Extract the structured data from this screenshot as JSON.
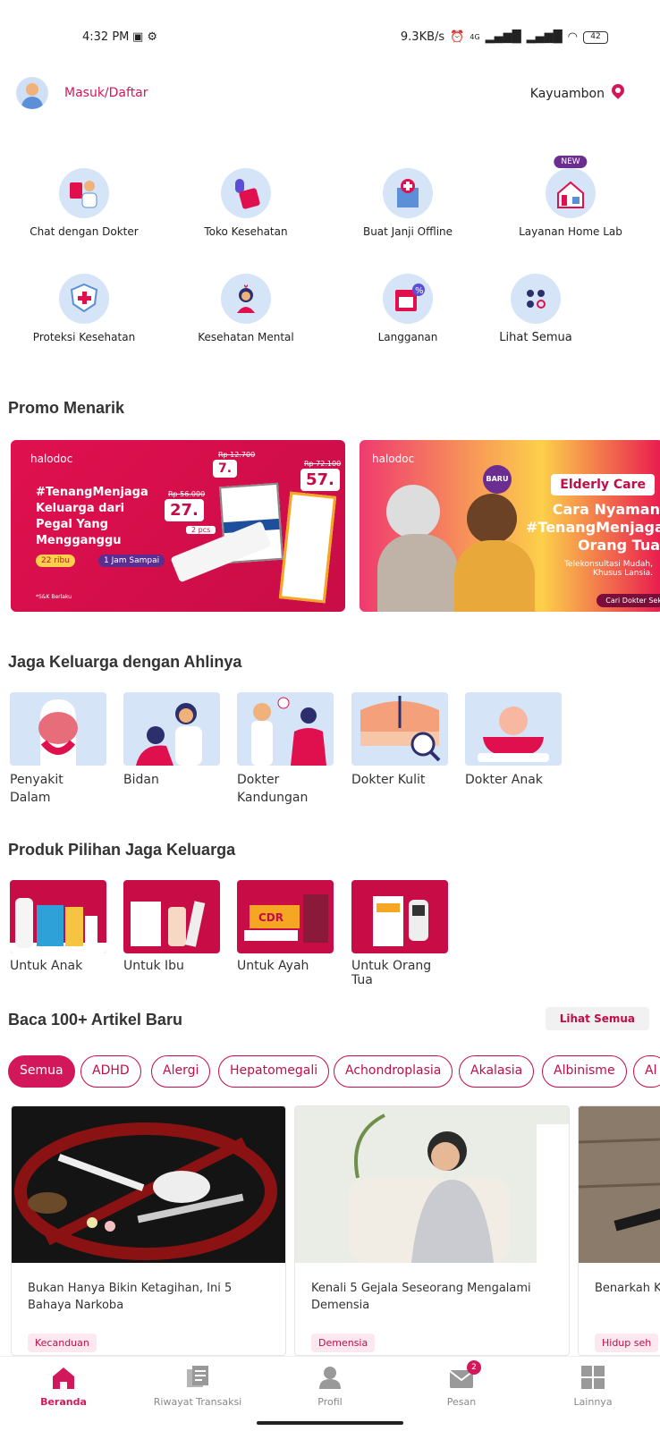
{
  "status": {
    "time": "4:32 PM",
    "speed": "9.3KB/s",
    "network": "4G",
    "battery": "42"
  },
  "header": {
    "login": "Masuk/Daftar",
    "location": "Kayuambon"
  },
  "services": [
    {
      "label": "Chat dengan Dokter",
      "icon": "doctor-icon"
    },
    {
      "label": "Toko Kesehatan",
      "icon": "medicine-icon"
    },
    {
      "label": "Buat Janji Offline",
      "icon": "hospital-icon"
    },
    {
      "label": "Layanan Home Lab",
      "icon": "home-lab-icon",
      "badge": "NEW"
    },
    {
      "label": "Proteksi Kesehatan",
      "icon": "shield-icon"
    },
    {
      "label": "Kesehatan Mental",
      "icon": "mental-health-icon"
    },
    {
      "label": "Langganan",
      "icon": "subscription-icon"
    },
    {
      "label": "Lihat Semua",
      "icon": "grid-dots-icon"
    }
  ],
  "promo": {
    "title": "Promo Menarik",
    "banner1": {
      "brand": "halodoc",
      "headline": "#TenangMenjaga Keluarga dari Pegal Yang Mengganggu",
      "old1": "Rp 56.000",
      "new1": "27.",
      "pcs": "2 pcs",
      "old2": "Rp 12.700",
      "new2": "7.",
      "old3": "Rp 72.100",
      "new3": "57.",
      "pill1": "22 ribu",
      "pill2": "1 Jam Sampai",
      "note": "*S&K Berlaku"
    },
    "banner2": {
      "brand": "halodoc",
      "badge": "BARU",
      "title": "Elderly Care",
      "text": "Cara Nyaman #TenangMenjaga Orang Tua",
      "note": "Telekonsultasi Mudah, Khusus Lansia.",
      "button": "Cari Dokter Sek"
    }
  },
  "specialists": {
    "title": "Jaga Keluarga dengan Ahlinya",
    "items": [
      "Penyakit Dalam",
      "Bidan",
      "Dokter Kandungan",
      "Dokter Kulit",
      "Dokter Anak"
    ]
  },
  "products": {
    "title": "Produk Pilihan Jaga Keluarga",
    "items": [
      "Untuk Anak",
      "Untuk Ibu",
      "Untuk Ayah",
      "Untuk Orang Tua"
    ]
  },
  "articles": {
    "title": "Baca 100+ Artikel Baru",
    "see_all": "Lihat Semua",
    "chips": [
      "Semua",
      "ADHD",
      "Alergi",
      "Hepatomegali",
      "Achondroplasia",
      "Akalasia",
      "Albinisme",
      "Al"
    ],
    "cards": [
      {
        "title": "Bukan Hanya Bikin Ketagihan, Ini 5 Bahaya Narkoba",
        "tag": "Kecanduan"
      },
      {
        "title": "Kenali 5 Gejala Seseorang Mengalami Demensia",
        "tag": "Demensia"
      },
      {
        "title": "Benarkah Kimia Berb",
        "tag": "Hidup seh"
      }
    ]
  },
  "nav": [
    {
      "label": "Beranda",
      "icon": "home-icon"
    },
    {
      "label": "Riwayat Transaksi",
      "icon": "history-icon"
    },
    {
      "label": "Profil",
      "icon": "profile-icon"
    },
    {
      "label": "Pesan",
      "icon": "message-icon",
      "badge": "2"
    },
    {
      "label": "Lainnya",
      "icon": "more-grid-icon"
    }
  ],
  "colors": {
    "accent": "#d2185a",
    "accent_dark": "#c20d47",
    "icon_bg": "#d6e4f7",
    "purple": "#6c2d91"
  }
}
